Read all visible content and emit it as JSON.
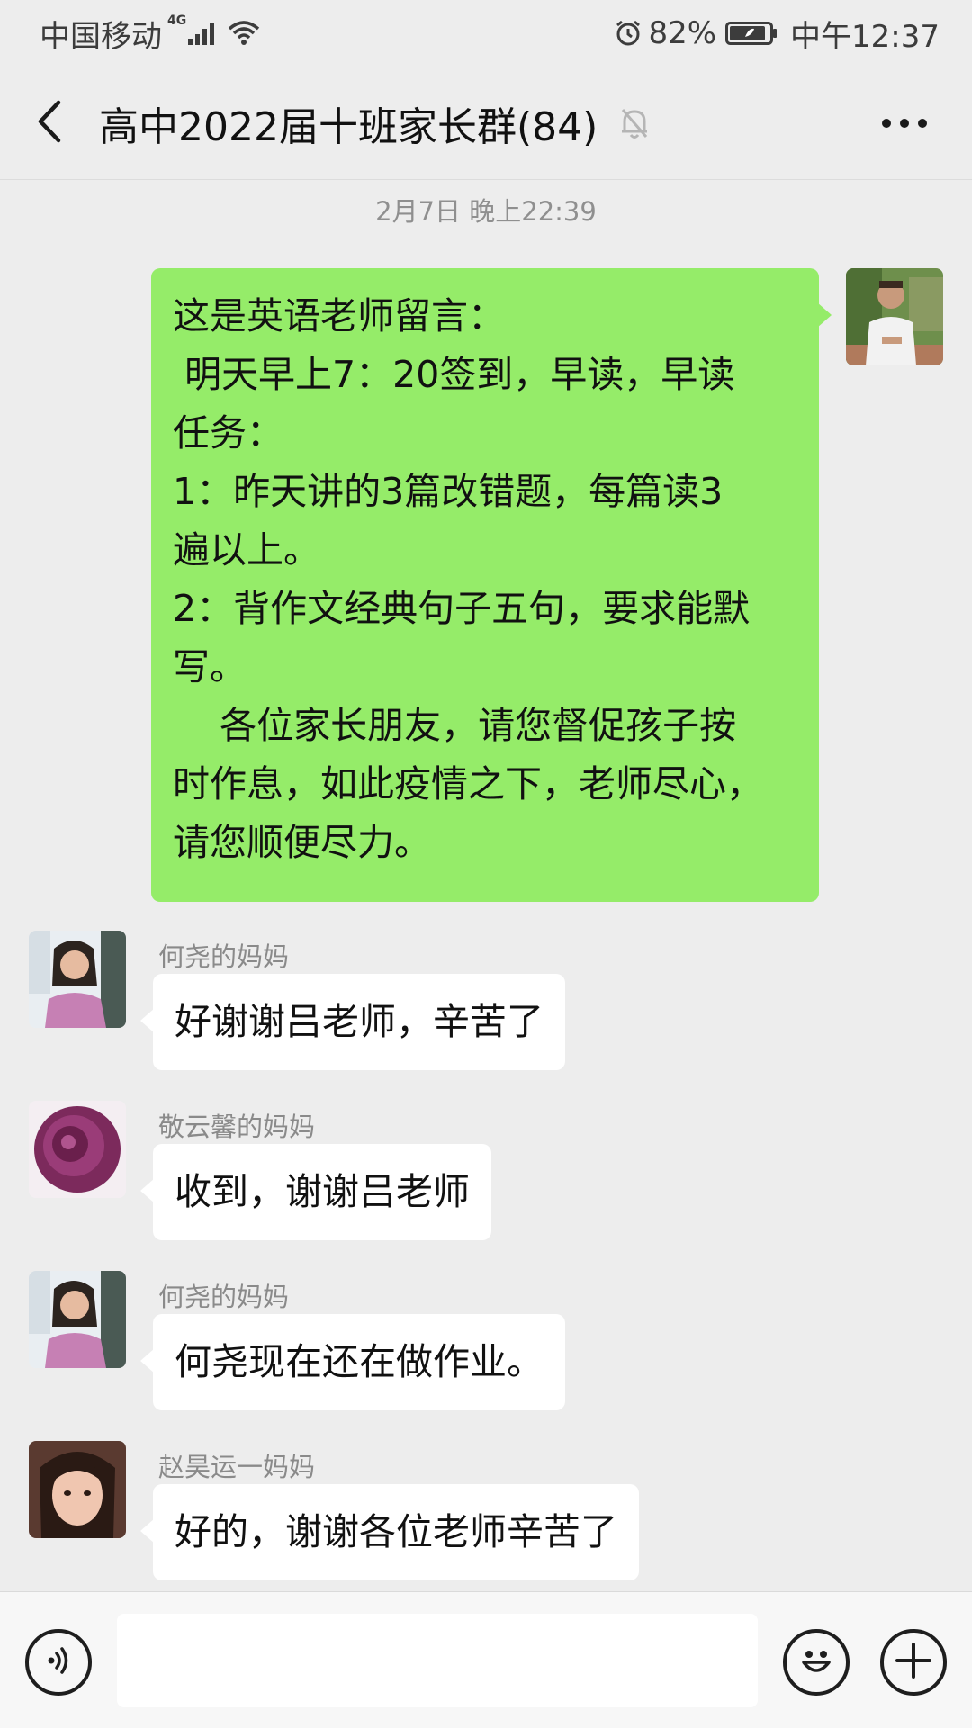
{
  "status_bar": {
    "carrier": "中国移动",
    "network_badge": "4G",
    "battery_percent": "82%",
    "time": "中午12:37"
  },
  "header": {
    "title": "高中2022届十班家长群(84)"
  },
  "timestamp": "2月7日 晚上22:39",
  "messages": [
    {
      "from_self": true,
      "lines": [
        "这是英语老师留言：",
        " 明天早上7：20签到，早读，早读",
        "任务：",
        "1：昨天讲的3篇改错题，每篇读3",
        "遍以上。",
        "2：背作文经典句子五句，要求能默",
        "写。",
        "    各位家长朋友，请您督促孩子按",
        "时作息，如此疫情之下，老师尽心，",
        "请您顺便尽力。"
      ]
    },
    {
      "from_self": false,
      "sender": "何尧的妈妈",
      "text": "好谢谢吕老师，辛苦了"
    },
    {
      "from_self": false,
      "sender": "敬云馨的妈妈",
      "text": "收到，谢谢吕老师"
    },
    {
      "from_self": false,
      "sender": "何尧的妈妈",
      "text": "何尧现在还在做作业。"
    },
    {
      "from_self": false,
      "sender": "赵昊运一妈妈",
      "text": "好的，谢谢各位老师辛苦了"
    }
  ],
  "input": {
    "value": ""
  },
  "icons": {
    "back": "chevron-left-icon",
    "mute": "bell-off-icon",
    "more": "more-horizontal-icon",
    "voice": "voice-icon",
    "emoji": "emoji-icon",
    "plus": "plus-icon"
  },
  "colors": {
    "self_bubble": "#95ec69",
    "other_bubble": "#ffffff",
    "background": "#ededed"
  }
}
